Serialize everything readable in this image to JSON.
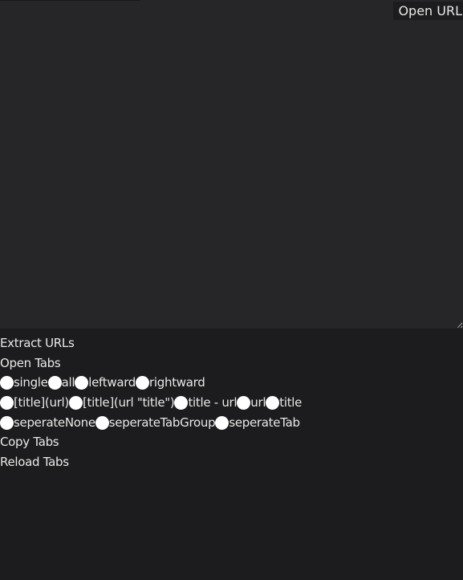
{
  "open_url_label": "Open URL",
  "buttons": {
    "extract": "Extract URLs",
    "open_tabs": "Open Tabs",
    "copy_tabs": "Copy Tabs",
    "reload_tabs": "Reload Tabs"
  },
  "scope_options": [
    "single",
    "all",
    "leftward",
    "rightward"
  ],
  "format_options": [
    "[title](url)",
    "[title](url \"title\")",
    "title - url",
    "url",
    "title"
  ],
  "separate_options": [
    "seperateNone",
    "seperateTabGroup",
    "seperateTab"
  ]
}
